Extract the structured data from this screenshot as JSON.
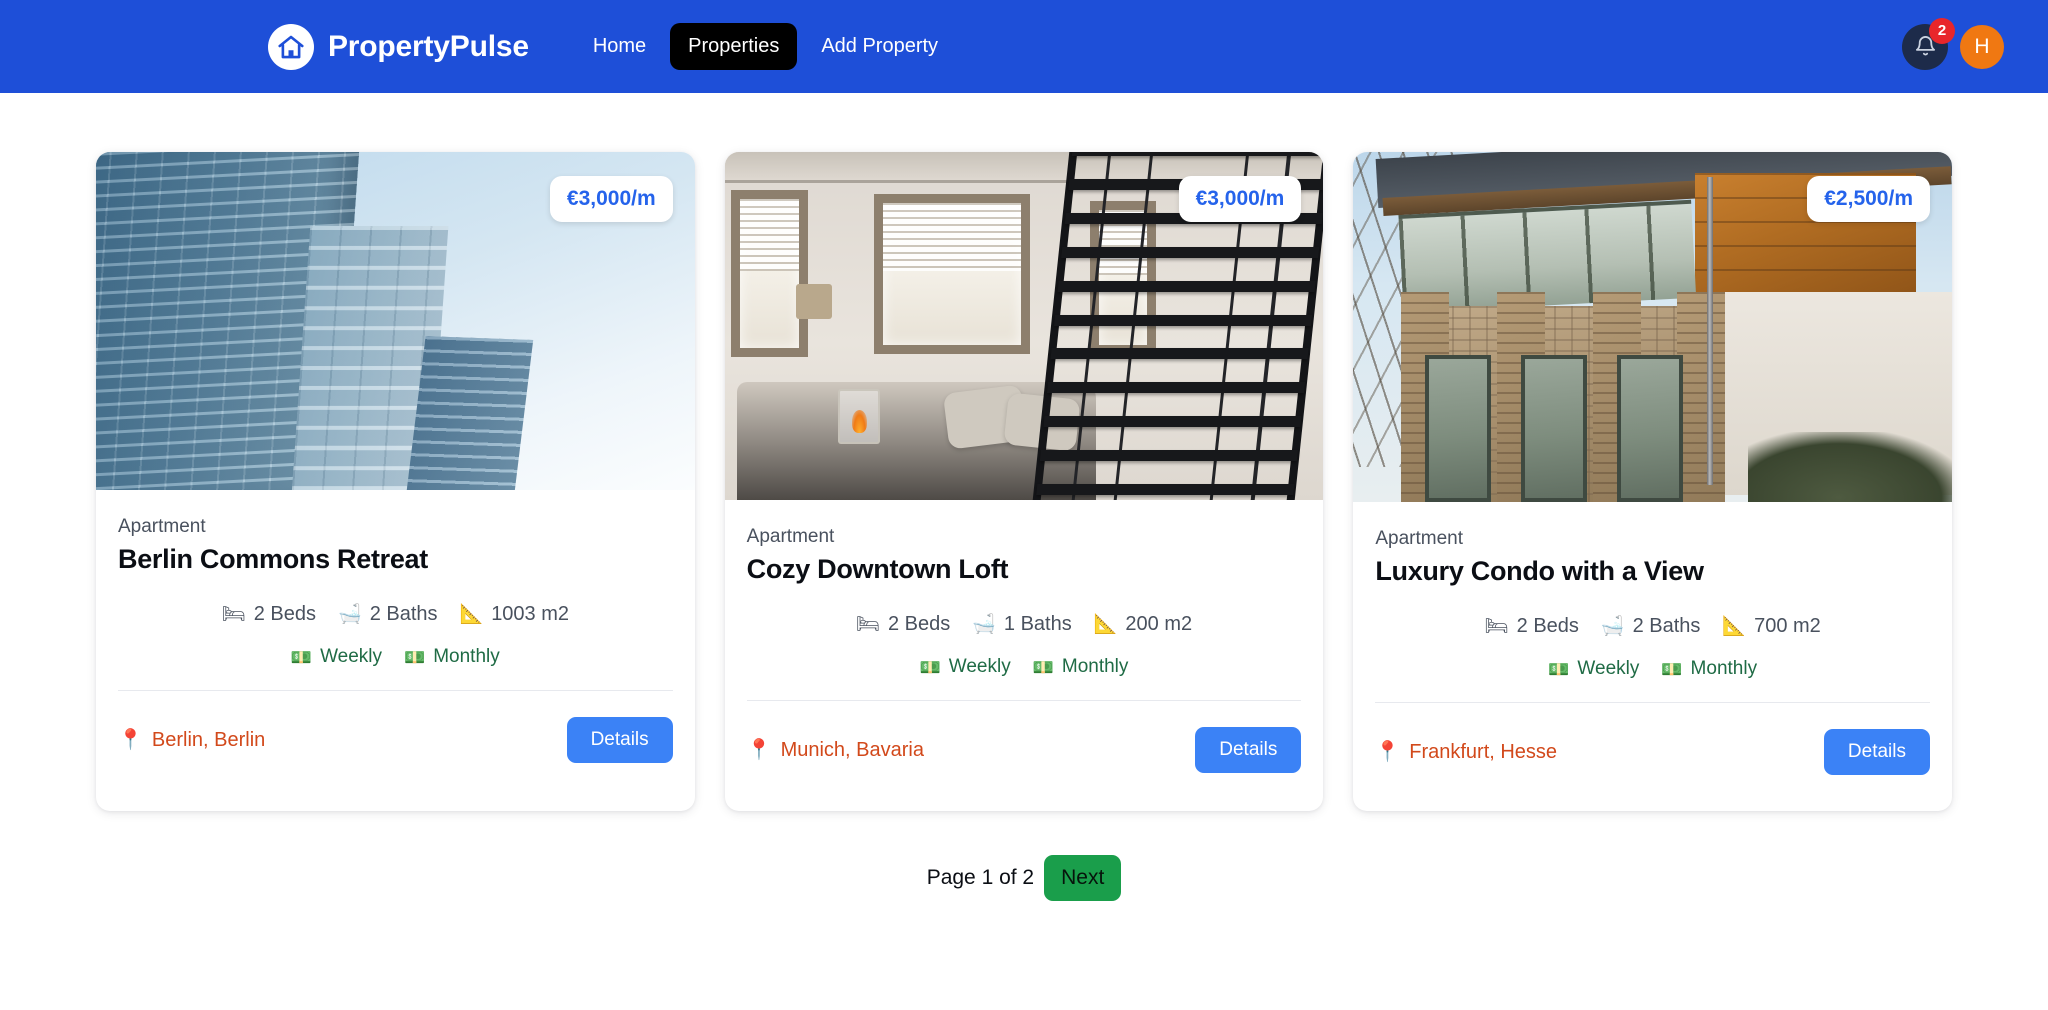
{
  "navbar": {
    "brand": {
      "name": "PropertyPulse",
      "icon": "house-icon"
    },
    "links": [
      {
        "label": "Home",
        "active": false
      },
      {
        "label": "Properties",
        "active": true
      },
      {
        "label": "Add Property",
        "active": false
      }
    ],
    "notifications": {
      "icon": "bell-icon",
      "count": "2"
    },
    "avatar_initial": "H"
  },
  "properties": [
    {
      "price": "€3,000/m",
      "type": "Apartment",
      "title": "Berlin Commons Retreat",
      "beds": "2 Beds",
      "baths": "2 Baths",
      "area": "1003 m2",
      "rates": [
        "Weekly",
        "Monthly"
      ],
      "location": "Berlin, Berlin",
      "details_label": "Details"
    },
    {
      "price": "€3,000/m",
      "type": "Apartment",
      "title": "Cozy Downtown Loft",
      "beds": "2 Beds",
      "baths": "1 Baths",
      "area": "200 m2",
      "rates": [
        "Weekly",
        "Monthly"
      ],
      "location": "Munich, Bavaria",
      "details_label": "Details"
    },
    {
      "price": "€2,500/m",
      "type": "Apartment",
      "title": "Luxury Condo with a View",
      "beds": "2 Beds",
      "baths": "2 Baths",
      "area": "700 m2",
      "rates": [
        "Weekly",
        "Monthly"
      ],
      "location": "Frankfurt, Hesse",
      "details_label": "Details"
    }
  ],
  "icons": {
    "bed": "🛏",
    "bath": "🛁",
    "area": "📐",
    "money": "💵",
    "pin": "📍"
  },
  "pagination": {
    "status": "Page 1 of 2",
    "next_label": "Next"
  },
  "colors": {
    "navbar_blue": "#1e4fd8",
    "active_tab": "#000000",
    "price_text": "#2563eb",
    "details_button": "#3b82f6",
    "next_button": "#1a9e4b",
    "location_text": "#d2491b",
    "rate_text": "#1f6b45",
    "badge_red": "#e8262b",
    "avatar_orange": "#f07812"
  }
}
